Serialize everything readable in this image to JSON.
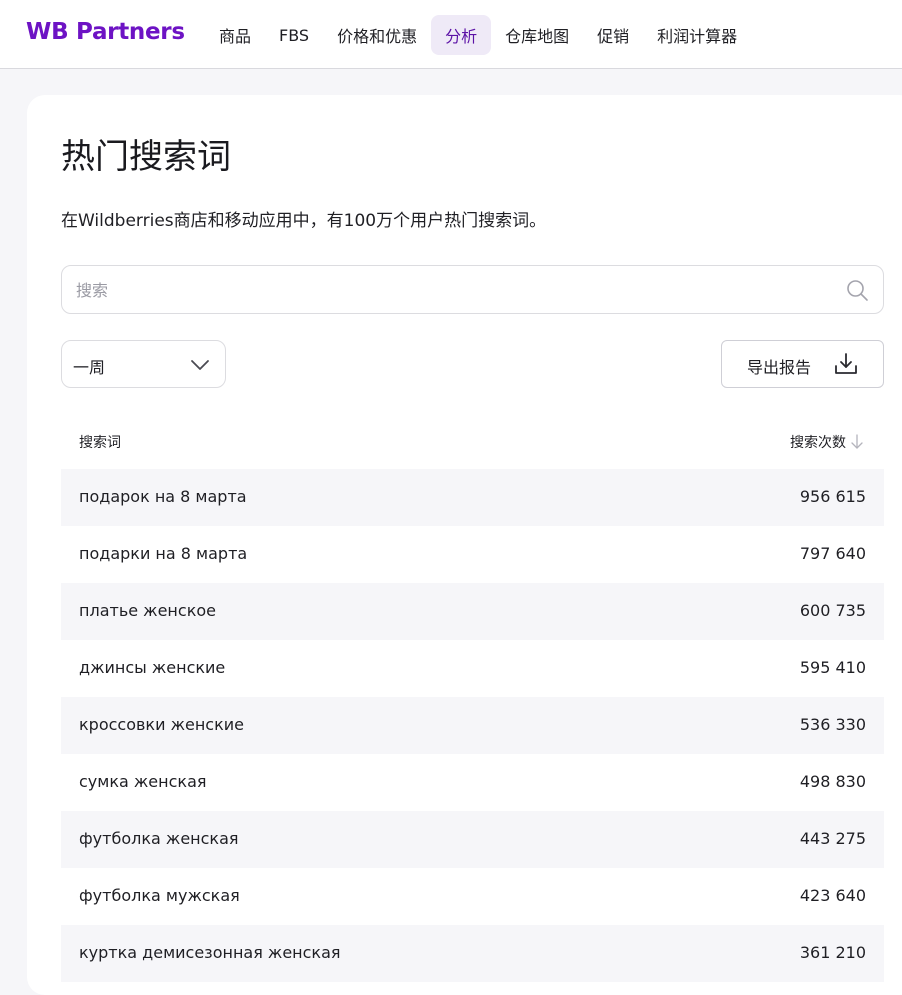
{
  "header": {
    "logo": "WB Partners",
    "nav": [
      {
        "label": "商品",
        "active": false
      },
      {
        "label": "FBS",
        "active": false
      },
      {
        "label": "价格和优惠",
        "active": false
      },
      {
        "label": "分析",
        "active": true
      },
      {
        "label": "仓库地图",
        "active": false
      },
      {
        "label": "促销",
        "active": false
      },
      {
        "label": "利润计算器",
        "active": false
      }
    ]
  },
  "page": {
    "title": "热门搜索词",
    "subtitle": "在Wildberries商店和移动应用中，有100万个用户热门搜索词。"
  },
  "search": {
    "placeholder": "搜索",
    "value": "",
    "icon": "search-icon"
  },
  "filters": {
    "period_selected": "一周",
    "period_icon": "chevron-down-icon",
    "export_label": "导出报告",
    "export_icon": "download-icon"
  },
  "table": {
    "columns": {
      "term": "搜索词",
      "count": "搜索次数",
      "count_sort_icon": "arrow-down-icon"
    },
    "rows": [
      {
        "term": "подарок на 8 марта",
        "count": "956 615"
      },
      {
        "term": "подарки на 8 марта",
        "count": "797 640"
      },
      {
        "term": "платье женское",
        "count": "600 735"
      },
      {
        "term": "джинсы женские",
        "count": "595 410"
      },
      {
        "term": "кроссовки женские",
        "count": "536 330"
      },
      {
        "term": "сумка женская",
        "count": "498 830"
      },
      {
        "term": "футболка женская",
        "count": "443 275"
      },
      {
        "term": "футболка мужская",
        "count": "423 640"
      },
      {
        "term": "куртка демисезонная женская",
        "count": "361 210"
      }
    ]
  },
  "colors": {
    "brand": "#6d13c4",
    "nav_active_bg": "#efeaf7",
    "row_stripe": "#f6f6f9"
  }
}
